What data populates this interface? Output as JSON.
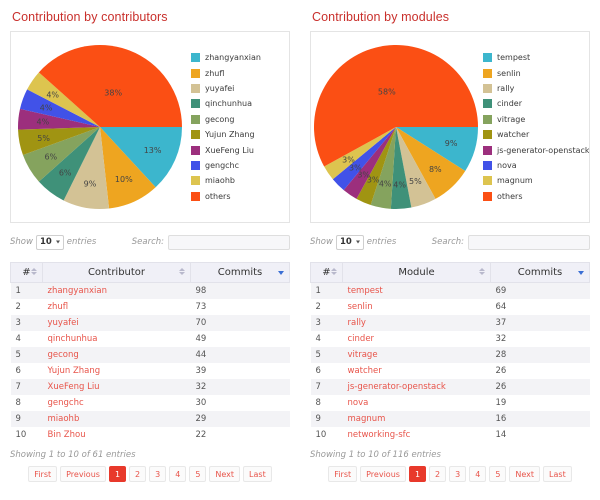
{
  "theme": {
    "title_color": "#c9302c",
    "link_color": "#e8544a",
    "active_page_bg": "#e8392b",
    "header_bg": "#f0f0f7",
    "sort_arrow_color": "#3b6fd4"
  },
  "panels": [
    {
      "id": "contributors",
      "title": "Contribution by contributors",
      "controls": {
        "show_label": "Show",
        "entries_label": "entries",
        "page_length": "10",
        "search_label": "Search:",
        "search_value": "",
        "search_placeholder": ""
      },
      "table": {
        "columns": [
          "#",
          "Contributor",
          "Commits"
        ],
        "sort": {
          "column": "Commits",
          "direction": "desc"
        },
        "rows": [
          {
            "idx": "1",
            "name": "zhangyanxian",
            "commits": "98"
          },
          {
            "idx": "2",
            "name": "zhufl",
            "commits": "73"
          },
          {
            "idx": "3",
            "name": "yuyafei",
            "commits": "70"
          },
          {
            "idx": "4",
            "name": "qinchunhua",
            "commits": "49"
          },
          {
            "idx": "5",
            "name": "gecong",
            "commits": "44"
          },
          {
            "idx": "6",
            "name": "Yujun Zhang",
            "commits": "39"
          },
          {
            "idx": "7",
            "name": "XueFeng Liu",
            "commits": "32"
          },
          {
            "idx": "8",
            "name": "gengchc",
            "commits": "30"
          },
          {
            "idx": "9",
            "name": "miaohb",
            "commits": "29"
          },
          {
            "idx": "10",
            "name": "Bin Zhou",
            "commits": "22"
          }
        ]
      },
      "info": "Showing 1 to 10 of 61 entries",
      "pagination": {
        "first": "First",
        "previous": "Previous",
        "pages": [
          "1",
          "2",
          "3",
          "4",
          "5"
        ],
        "active_page": "1",
        "next": "Next",
        "last": "Last"
      }
    },
    {
      "id": "modules",
      "title": "Contribution by modules",
      "controls": {
        "show_label": "Show",
        "entries_label": "entries",
        "page_length": "10",
        "search_label": "Search:",
        "search_value": "",
        "search_placeholder": ""
      },
      "table": {
        "columns": [
          "#",
          "Module",
          "Commits"
        ],
        "sort": {
          "column": "Commits",
          "direction": "desc"
        },
        "rows": [
          {
            "idx": "1",
            "name": "tempest",
            "commits": "69"
          },
          {
            "idx": "2",
            "name": "senlin",
            "commits": "64"
          },
          {
            "idx": "3",
            "name": "rally",
            "commits": "37"
          },
          {
            "idx": "4",
            "name": "cinder",
            "commits": "32"
          },
          {
            "idx": "5",
            "name": "vitrage",
            "commits": "28"
          },
          {
            "idx": "6",
            "name": "watcher",
            "commits": "26"
          },
          {
            "idx": "7",
            "name": "js-generator-openstack",
            "commits": "26"
          },
          {
            "idx": "8",
            "name": "nova",
            "commits": "19"
          },
          {
            "idx": "9",
            "name": "magnum",
            "commits": "16"
          },
          {
            "idx": "10",
            "name": "networking-sfc",
            "commits": "14"
          }
        ]
      },
      "info": "Showing 1 to 10 of 116 entries",
      "pagination": {
        "first": "First",
        "previous": "Previous",
        "pages": [
          "1",
          "2",
          "3",
          "4",
          "5"
        ],
        "active_page": "1",
        "next": "Next",
        "last": "Last"
      }
    }
  ],
  "chart_data": [
    {
      "type": "pie",
      "id": "contributors-pie",
      "title": "Contribution by contributors",
      "legend_position": "right",
      "start_angle": 0,
      "direction": "clockwise",
      "labels": [
        "zhangyanxian",
        "zhufl",
        "yuyafei",
        "qinchunhua",
        "gecong",
        "Yujun Zhang",
        "XueFeng Liu",
        "gengchc",
        "miaohb",
        "others"
      ],
      "values": [
        13,
        10,
        9,
        6,
        6,
        5,
        4,
        4,
        4,
        38
      ],
      "data_labels": [
        "13%",
        "10%",
        "9%",
        "6%",
        "6%",
        "5%",
        "4%",
        "4%",
        "4%",
        "38%"
      ],
      "colors": [
        "#3cb6cd",
        "#eea520",
        "#d3c295",
        "#3f9179",
        "#85a35e",
        "#a09412",
        "#9c2f7d",
        "#4152e8",
        "#ddc44f",
        "#fb4f14"
      ]
    },
    {
      "type": "pie",
      "id": "modules-pie",
      "title": "Contribution by modules",
      "legend_position": "right",
      "start_angle": 0,
      "direction": "clockwise",
      "labels": [
        "tempest",
        "senlin",
        "rally",
        "cinder",
        "vitrage",
        "watcher",
        "js-generator-openstack",
        "nova",
        "magnum",
        "others"
      ],
      "values": [
        9,
        8,
        5,
        4,
        4,
        3,
        3,
        3,
        3,
        58
      ],
      "data_labels": [
        "9%",
        "8%",
        "5%",
        "4%",
        "4%",
        "3%",
        "3%",
        "3%",
        "3%",
        "58%"
      ],
      "colors": [
        "#3cb6cd",
        "#eea520",
        "#d3c295",
        "#3f9179",
        "#85a35e",
        "#a09412",
        "#9c2f7d",
        "#4152e8",
        "#ddc44f",
        "#fb4f14"
      ]
    }
  ]
}
